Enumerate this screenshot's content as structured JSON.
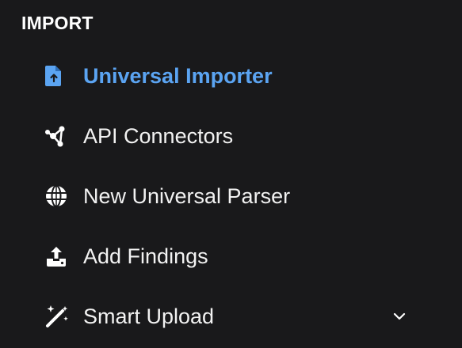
{
  "section": {
    "title": "IMPORT"
  },
  "nav": {
    "items": [
      {
        "label": "Universal Importer",
        "icon": "file-upload-icon",
        "active": true
      },
      {
        "label": "API Connectors",
        "icon": "connectors-icon",
        "active": false
      },
      {
        "label": "New Universal Parser",
        "icon": "globe-icon",
        "active": false
      },
      {
        "label": "Add Findings",
        "icon": "upload-tray-icon",
        "active": false
      },
      {
        "label": "Smart Upload",
        "icon": "magic-wand-icon",
        "active": false,
        "expandable": true
      }
    ]
  },
  "colors": {
    "background": "#19191b",
    "active": "#5ba4f2",
    "text": "#f2f2f2"
  }
}
